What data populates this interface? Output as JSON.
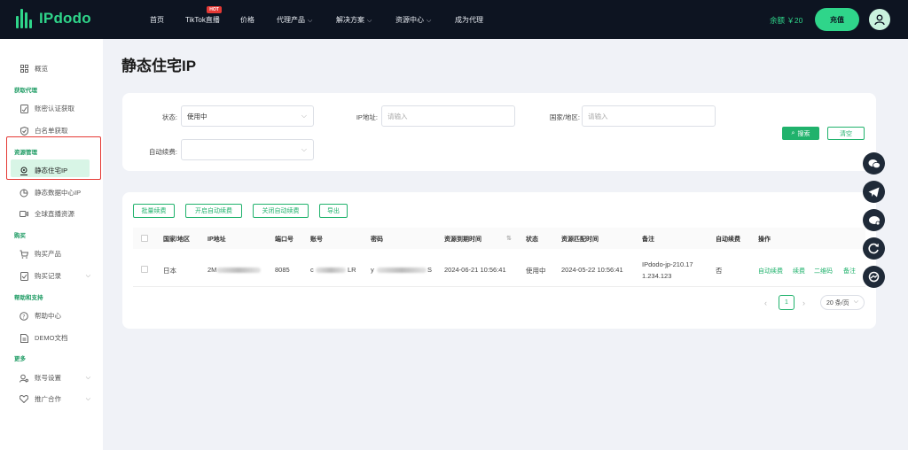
{
  "app": {
    "logo_text": "IPdodo"
  },
  "nav": {
    "items": [
      "首页",
      "TikTok直播",
      "价格",
      "代理产品",
      "解决方案",
      "资源中心",
      "成为代理"
    ],
    "hot_badge": "HOT",
    "balance": "余额 ￥20",
    "recharge_label": "充值"
  },
  "sidebar": {
    "overview": "概览",
    "sec_get": "获取代理",
    "account_auth": "账密认证获取",
    "whitelist": "白名单获取",
    "sec_resource": "资源管理",
    "static_ip": "静态住宅IP",
    "static_dc": "静态数据中心IP",
    "global_live": "全球直播资源",
    "sec_buy": "购买",
    "buy_product": "购买产品",
    "buy_record": "购买记录",
    "sec_help": "帮助和支持",
    "help_center": "帮助中心",
    "demo_doc": "DEMO文档",
    "sec_more": "更多",
    "account_settings": "账号设置",
    "promo": "推广合作"
  },
  "main": {
    "title": "静态住宅IP",
    "filters": {
      "status_label": "状态:",
      "status_value": "使用中",
      "ip_label": "IP地址:",
      "ip_placeholder": "请输入",
      "country_label": "国家/地区:",
      "country_placeholder": "请输入",
      "auto_label": "自动续费:",
      "auto_value": "",
      "search_label": "搜索",
      "clear_label": "清空"
    },
    "actions": {
      "bulk_renew": "批量续费",
      "enable_auto": "开启自动续费",
      "disable_auto": "关闭自动续费",
      "export": "导出"
    },
    "table": {
      "headers": [
        "国家/地区",
        "IP地址",
        "端口号",
        "账号",
        "密码",
        "资源到期时间",
        "状态",
        "资源匹配时间",
        "备注",
        "自动续费",
        "操作"
      ],
      "row": {
        "country": "日本",
        "ip_partial": "2M",
        "port": "8085",
        "account_prefix": "c",
        "account_suffix": "LR",
        "password_prefix": "y",
        "password_suffix": "S",
        "expire": "2024-06-21 10:56:41",
        "status": "使用中",
        "match_time": "2024-05-22 10:56:41",
        "note_line1": "IPdodo-jp-210.17",
        "note_line2": "1.234.123",
        "auto_renew": "否",
        "ops": [
          "自动续费",
          "续费",
          "二维码",
          "备注"
        ]
      }
    },
    "pagination": {
      "current": "1",
      "page_size": "20 条/页"
    }
  }
}
